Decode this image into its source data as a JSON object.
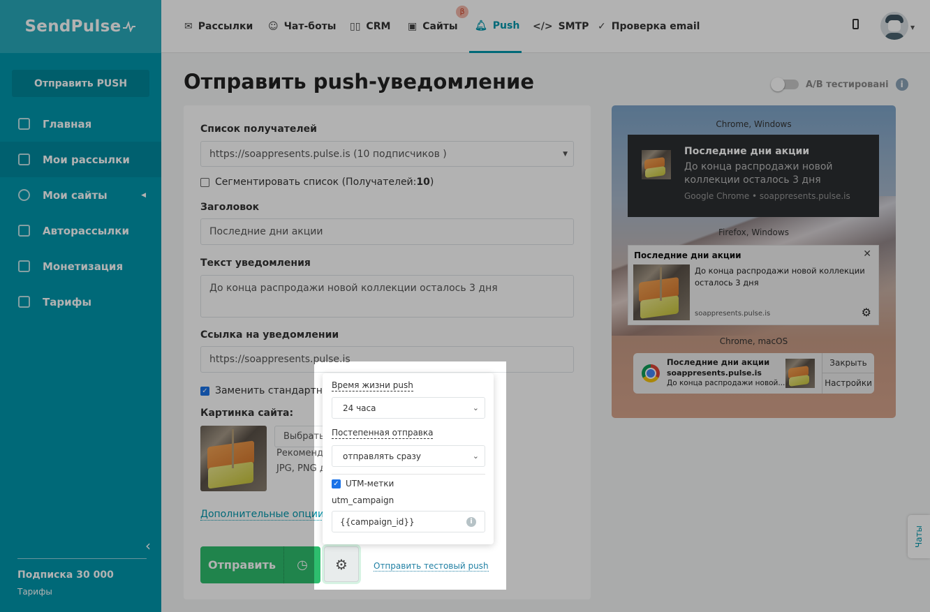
{
  "app": {
    "logo": "SendPulse"
  },
  "sidebar": {
    "cta": "Отправить PUSH",
    "items": [
      {
        "label": "Главная"
      },
      {
        "label": "Мои рассылки",
        "active": true
      },
      {
        "label": "Мои сайты"
      },
      {
        "label": "Авторассылки"
      },
      {
        "label": "Монетизация"
      },
      {
        "label": "Тарифы"
      }
    ],
    "subscription": "Подписка 30 000",
    "tariffs_link": "Тарифы"
  },
  "header": {
    "tabs": [
      {
        "label": "Рассылки"
      },
      {
        "label": "Чат-боты"
      },
      {
        "label": "CRM"
      },
      {
        "label": "Сайты",
        "badge": "β"
      },
      {
        "label": "Push",
        "active": true
      },
      {
        "label": "SMTP"
      },
      {
        "label": "Проверка email"
      }
    ]
  },
  "page": {
    "title": "Отправить push-уведомление",
    "ab_label": "A/B тестировані",
    "ab_info": "i"
  },
  "form": {
    "recipients_label": "Список получателей",
    "recipients_value": "https://soappresents.pulse.is (10 подписчиков )",
    "segment_label": "Сегментировать список (Получателей: ",
    "segment_count": "10",
    "segment_close": ")",
    "title_label": "Заголовок",
    "title_value": "Последние дни акции",
    "text_label": "Текст уведомления",
    "text_value": "До конца распродажи новой коллекции осталось 3 дня",
    "link_label": "Ссылка на уведомлении",
    "link_value": "https://soappresents.pulse.is",
    "replace_icon_label": "Заменить стандартную",
    "image_label": "Картинка сайта:",
    "choose_image": "Выбрать и",
    "hint1": "Рекомендуе",
    "hint2": "JPG, PNG до",
    "more_options": "Дополнительные опции",
    "send": "Отправить",
    "test_push": "Отправить тестовый push"
  },
  "popup": {
    "ttl_label": "Время жизни push",
    "ttl_value": "24 часа",
    "gradual_label": "Постепенная отправка",
    "gradual_value": "отправлять сразу",
    "utm_label": "UTM-метки",
    "utm_checked": true,
    "utm_campaign_label": "utm_campaign",
    "utm_campaign_value": "{{campaign_id}}"
  },
  "preview": {
    "chrome_win_label": "Chrome, Windows",
    "firefox_label": "Firefox, Windows",
    "mac_label": "Chrome, macOS",
    "title": "Последние дни акции",
    "body": "До конца распродажи новой коллекции осталось 3 дня",
    "chrome_source": "Google Chrome • soappresents.pulse.is",
    "domain": "soappresents.pulse.is",
    "mac_body": "До конца распродажи новой...",
    "close": "Закрыть",
    "settings": "Настройки"
  },
  "chat": {
    "label": "Чаты"
  }
}
